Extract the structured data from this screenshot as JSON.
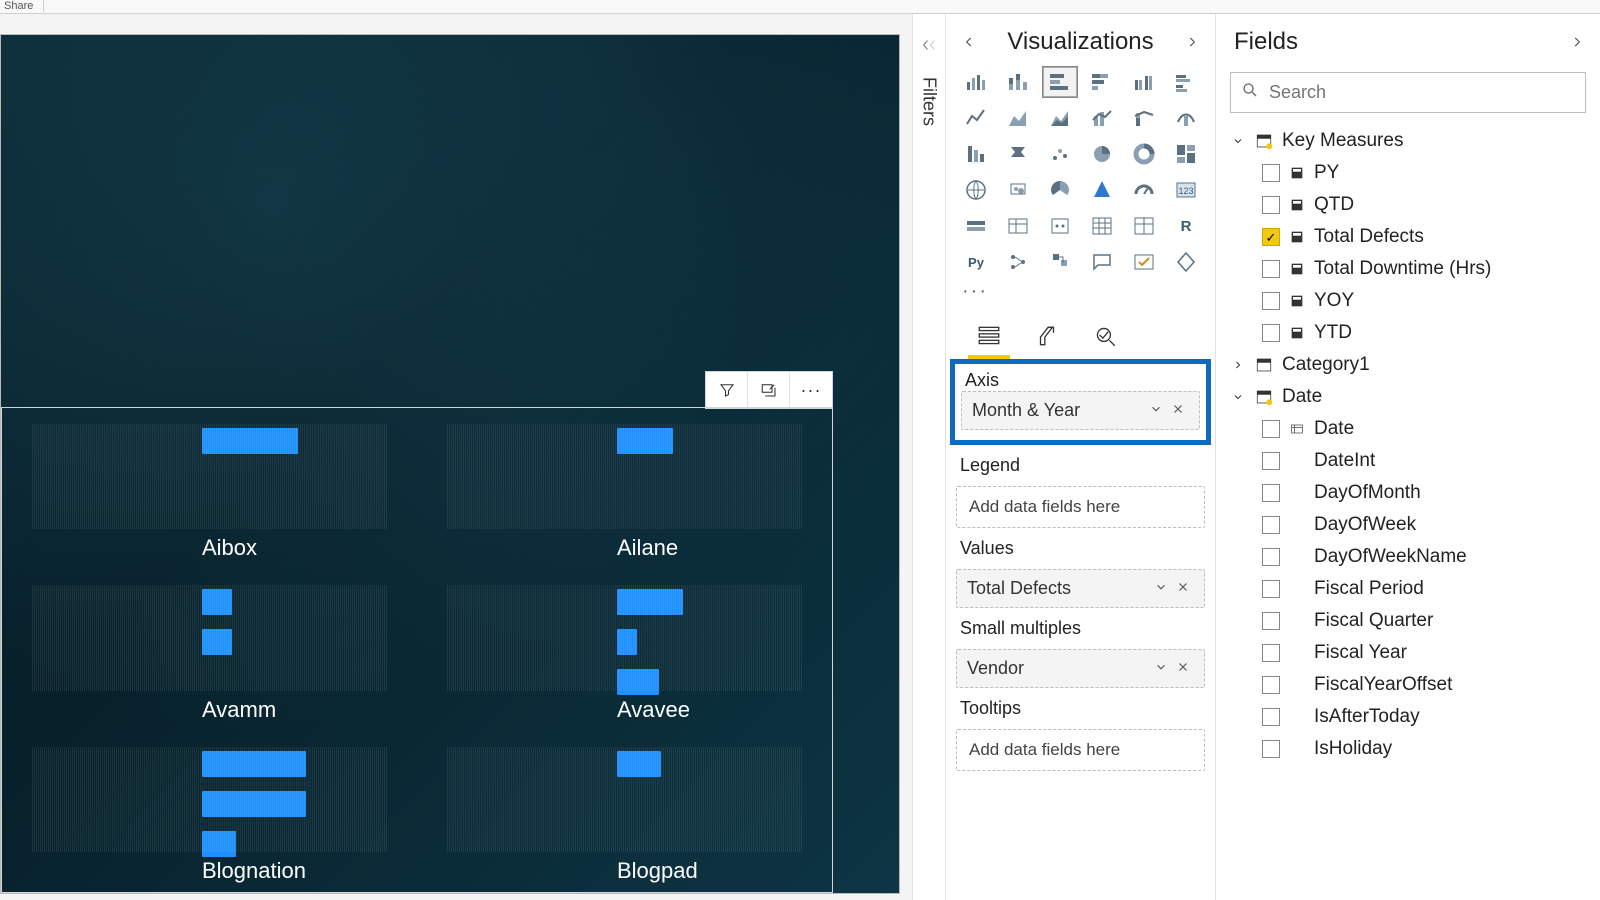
{
  "top": {
    "share": "Share"
  },
  "filters": {
    "label": "Filters"
  },
  "canvas": {
    "small_multiples": [
      {
        "name": "Aibox",
        "bars": [
          96
        ]
      },
      {
        "name": "Ailane",
        "bars": [
          56
        ]
      },
      {
        "name": "Avamm",
        "bars": [
          30,
          30
        ]
      },
      {
        "name": "Avavee",
        "bars": [
          66,
          20,
          42
        ]
      },
      {
        "name": "Blognation",
        "bars": [
          104,
          104,
          34
        ]
      },
      {
        "name": "Blogpad",
        "bars": [
          44
        ]
      }
    ]
  },
  "viz": {
    "title": "Visualizations",
    "ellipsis": "···",
    "wells": {
      "axis": {
        "label": "Axis",
        "field": "Month & Year"
      },
      "legend": {
        "label": "Legend",
        "placeholder": "Add data fields here"
      },
      "values": {
        "label": "Values",
        "field": "Total Defects"
      },
      "sm": {
        "label": "Small multiples",
        "field": "Vendor"
      },
      "tt": {
        "label": "Tooltips",
        "placeholder": "Add data fields here"
      }
    }
  },
  "fields": {
    "title": "Fields",
    "search_placeholder": "Search",
    "tables": [
      {
        "name": "Key Measures",
        "icon": "measure-table",
        "expanded": true,
        "items": [
          {
            "name": "PY",
            "checked": false,
            "icon": "measure"
          },
          {
            "name": "QTD",
            "checked": false,
            "icon": "measure"
          },
          {
            "name": "Total Defects",
            "checked": true,
            "icon": "measure"
          },
          {
            "name": "Total Downtime (Hrs)",
            "checked": false,
            "icon": "measure"
          },
          {
            "name": "YOY",
            "checked": false,
            "icon": "measure"
          },
          {
            "name": "YTD",
            "checked": false,
            "icon": "measure"
          }
        ]
      },
      {
        "name": "Category1",
        "icon": "table",
        "expanded": false,
        "items": []
      },
      {
        "name": "Date",
        "icon": "date-table",
        "expanded": true,
        "items": [
          {
            "name": "Date",
            "checked": false,
            "icon": "hierarchy"
          },
          {
            "name": "DateInt",
            "checked": false,
            "icon": "none"
          },
          {
            "name": "DayOfMonth",
            "checked": false,
            "icon": "none"
          },
          {
            "name": "DayOfWeek",
            "checked": false,
            "icon": "none"
          },
          {
            "name": "DayOfWeekName",
            "checked": false,
            "icon": "none"
          },
          {
            "name": "Fiscal Period",
            "checked": false,
            "icon": "none"
          },
          {
            "name": "Fiscal Quarter",
            "checked": false,
            "icon": "none"
          },
          {
            "name": "Fiscal Year",
            "checked": false,
            "icon": "none"
          },
          {
            "name": "FiscalYearOffset",
            "checked": false,
            "icon": "none"
          },
          {
            "name": "IsAfterToday",
            "checked": false,
            "icon": "none"
          },
          {
            "name": "IsHoliday",
            "checked": false,
            "icon": "none"
          }
        ]
      }
    ]
  }
}
